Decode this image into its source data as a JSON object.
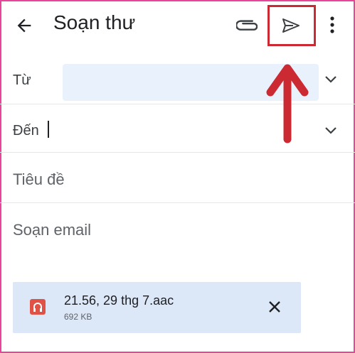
{
  "header": {
    "back_icon": "arrow-back-icon",
    "title": "Soạn thư",
    "attach_icon": "paperclip-icon",
    "send_icon": "send-icon",
    "more_icon": "more-vertical-icon"
  },
  "fields": {
    "from_label": "Từ",
    "to_label": "Đến",
    "subject_placeholder": "Tiêu đề",
    "body_placeholder": "Soạn email"
  },
  "attachment": {
    "name": "21.56, 29 thg 7.aac",
    "size": "692 KB",
    "icon": "headphones-file-icon",
    "remove_icon": "close-icon"
  },
  "annotation": {
    "highlight_color": "#cc2a33",
    "arrow": "up-arrow-annotation"
  },
  "colors": {
    "frame": "#e8459a",
    "from_field_bg": "#e9f1fc",
    "attachment_bg": "#dce7f7"
  }
}
